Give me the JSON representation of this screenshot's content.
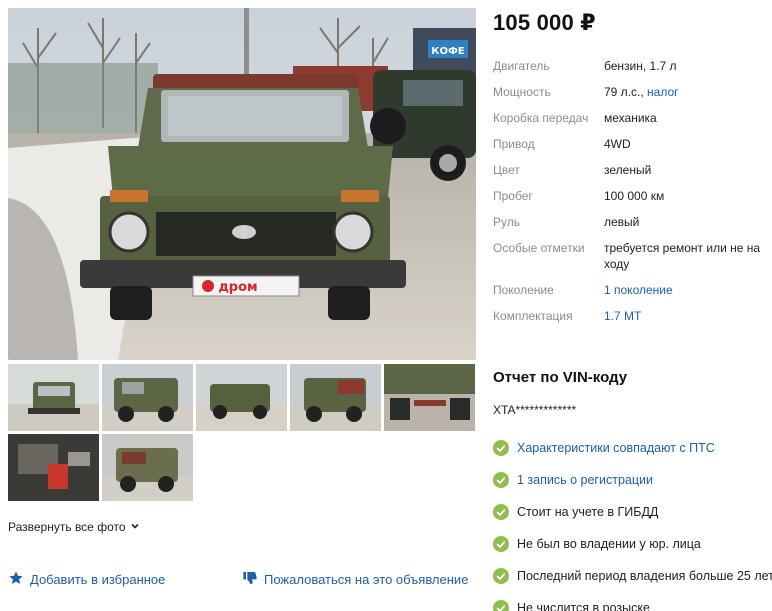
{
  "listing": {
    "price": "105 000 ₽",
    "watermark": "дром"
  },
  "specs": [
    {
      "key": "Двигатель",
      "value": "бензин, 1.7 л",
      "link": ""
    },
    {
      "key": "Мощность",
      "value": "79 л.с.,",
      "link": "налог"
    },
    {
      "key": "Коробка передач",
      "value": "механика",
      "link": ""
    },
    {
      "key": "Привод",
      "value": "4WD",
      "link": ""
    },
    {
      "key": "Цвет",
      "value": "зеленый",
      "link": ""
    },
    {
      "key": "Пробег",
      "value": "100 000 км",
      "link": ""
    },
    {
      "key": "Руль",
      "value": "левый",
      "link": ""
    },
    {
      "key": "Особые отметки",
      "value": "требуется ремонт или не на ходу",
      "link": ""
    },
    {
      "key": "Поколение",
      "value": "",
      "link": "1 поколение"
    },
    {
      "key": "Комплектация",
      "value": "",
      "link": "1.7 MT"
    }
  ],
  "vin": {
    "title": "Отчет по VIN-коду",
    "code": "XTA*************",
    "checks": [
      {
        "text": "Характеристики совпадают с ПТС",
        "is_link": true
      },
      {
        "text": "1 запись о регистрации",
        "is_link": true
      },
      {
        "text": "Стоит на учете в ГИБДД",
        "is_link": false
      },
      {
        "text": "Не был во владении у юр. лица",
        "is_link": false
      },
      {
        "text": "Последний период владения больше 25 лет",
        "is_link": false
      },
      {
        "text": "Не числится в розыске",
        "is_link": false
      }
    ]
  },
  "actions": {
    "expand_photos": "Развернуть все фото",
    "add_favorite": "Добавить в избранное",
    "complain": "Пожаловаться на это объявление"
  },
  "colors": {
    "link": "#1f5fa8",
    "check_green": "#8cc04a",
    "star_blue": "#1f5fa8"
  },
  "photos": {
    "thumbnail_count": 7
  }
}
